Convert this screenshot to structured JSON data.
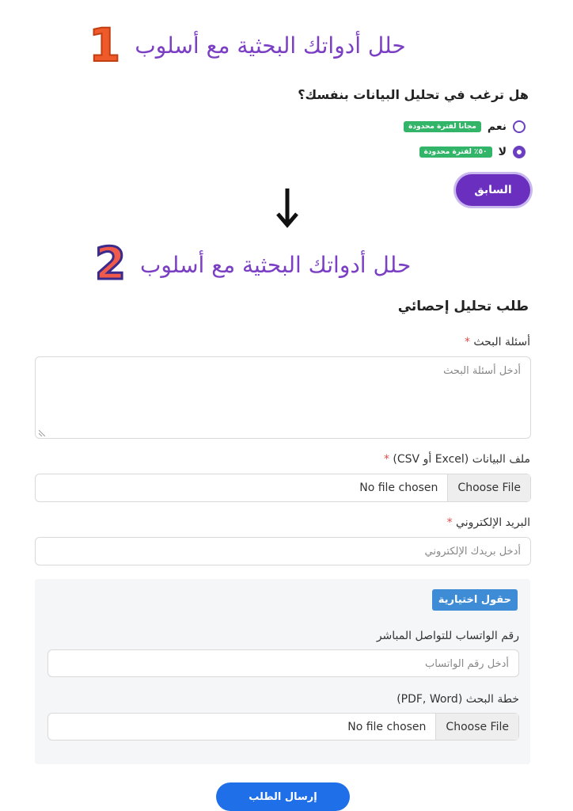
{
  "step1": {
    "number": "1",
    "title": "حلل أدواتك البحثية مع أسلوب"
  },
  "question": "هل ترغب في تحليل البيانات بنفسك؟",
  "options": [
    {
      "label": "نعم",
      "tag": "مجانا لفترة محدودة",
      "selected": false
    },
    {
      "label": "لا",
      "tag": "٥٠٪ لفترة محدودة",
      "selected": true
    }
  ],
  "prev_button": "السابق",
  "arrow_icon": "arrow-down-icon",
  "step2": {
    "number": "2",
    "title": "حلل أدواتك البحثية مع أسلوب"
  },
  "form": {
    "title": "طلب تحليل إحصائي",
    "research_questions": {
      "label": "أسئلة البحث",
      "required": "*",
      "placeholder": "أدخل أسئلة البحث"
    },
    "data_file": {
      "label": "ملف البيانات (Excel أو CSV)",
      "required": "*",
      "choose": "Choose File",
      "status": "No file chosen"
    },
    "email": {
      "label": "البريد الإلكتروني",
      "required": "*",
      "placeholder": "أدخل بريدك الإلكتروني"
    },
    "optional": {
      "badge": "حقول اختيارية",
      "whatsapp": {
        "label": "رقم الواتساب للتواصل المباشر",
        "placeholder": "أدخل رقم الواتساب"
      },
      "plan": {
        "label": "خطة البحث (PDF, Word)",
        "choose": "Choose File",
        "status": "No file chosen"
      }
    },
    "submit": "إرسال الطلب"
  },
  "colors": {
    "accent": "#6b2fc0",
    "tag_green": "#32b568",
    "submit_blue": "#1f6fe8",
    "badge_blue": "#3e8bd6"
  }
}
